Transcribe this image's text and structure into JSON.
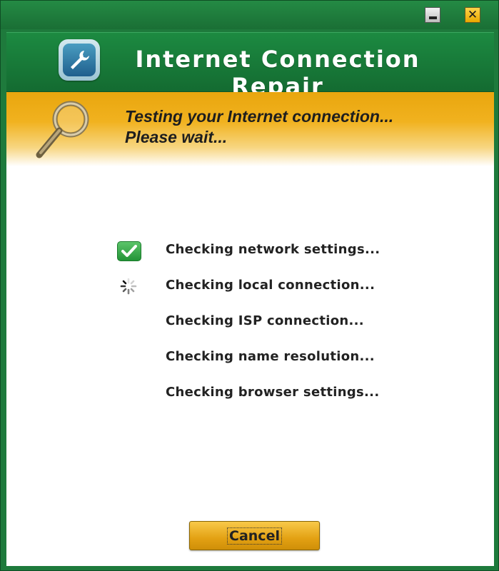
{
  "titlebar": {
    "minimize_icon": "minimize-icon",
    "close_icon": "close-icon"
  },
  "header": {
    "app_title": "Internet Connection Repair",
    "app_icon": "wrench-icon"
  },
  "status": {
    "icon": "magnifier-icon",
    "line1": "Testing your Internet connection...",
    "line2": "Please wait..."
  },
  "checks": [
    {
      "label": "Checking network settings...",
      "state": "done",
      "icon": "check-icon"
    },
    {
      "label": "Checking local connection...",
      "state": "in-progress",
      "icon": "spinner-icon"
    },
    {
      "label": "Checking ISP connection...",
      "state": "pending"
    },
    {
      "label": "Checking name resolution...",
      "state": "pending"
    },
    {
      "label": "Checking browser settings...",
      "state": "pending"
    }
  ],
  "footer": {
    "cancel_label": "Cancel"
  },
  "colors": {
    "frame_green": "#1e7a3c",
    "banner_green": "#1c8a41",
    "status_orange": "#f1b21f",
    "button_gold": "#e3a113",
    "check_green": "#239437"
  }
}
